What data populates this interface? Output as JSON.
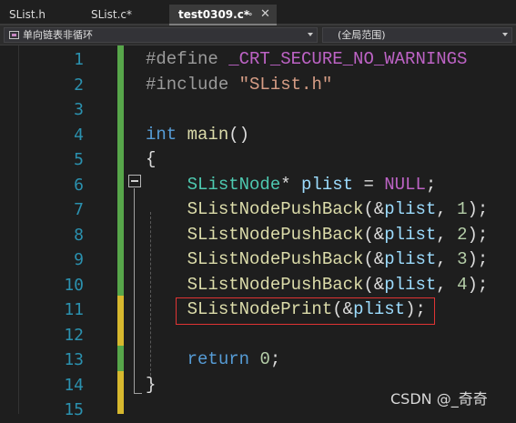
{
  "tabs": [
    {
      "label": "SList.h"
    },
    {
      "label": "SList.c*"
    },
    {
      "label": "test0309.c*",
      "active": true
    }
  ],
  "tab_icons": {
    "pin": "⊸",
    "close": "✕"
  },
  "navbar": {
    "scope_label": "单向链表非循环",
    "member_label": "(全局范围)"
  },
  "code_lines": [
    {
      "number": "1",
      "tokens": [
        {
          "t": "#define ",
          "c": "pp"
        },
        {
          "t": "_CRT_SECURE_NO_WARNINGS",
          "c": "cnst"
        }
      ]
    },
    {
      "number": "2",
      "tokens": [
        {
          "t": "#include ",
          "c": "pp"
        },
        {
          "t": "\"SList.h\"",
          "c": "str"
        }
      ]
    },
    {
      "number": "3",
      "tokens": []
    },
    {
      "number": "4",
      "tokens": [
        {
          "t": "int",
          "c": "kw"
        },
        {
          "t": " "
        },
        {
          "t": "main",
          "c": "fn"
        },
        {
          "t": "()"
        }
      ]
    },
    {
      "number": "5",
      "tokens": [
        {
          "t": "{"
        }
      ]
    },
    {
      "number": "6",
      "tokens": [
        {
          "t": "    "
        },
        {
          "t": "SListNode",
          "c": "type"
        },
        {
          "t": "* "
        },
        {
          "t": "plist",
          "c": "var"
        },
        {
          "t": " = "
        },
        {
          "t": "NULL",
          "c": "cnst"
        },
        {
          "t": ";"
        }
      ]
    },
    {
      "number": "7",
      "tokens": [
        {
          "t": "    "
        },
        {
          "t": "SListNodePushBack",
          "c": "fn"
        },
        {
          "t": "(&"
        },
        {
          "t": "plist",
          "c": "var"
        },
        {
          "t": ", "
        },
        {
          "t": "1",
          "c": "num"
        },
        {
          "t": ");"
        }
      ]
    },
    {
      "number": "8",
      "tokens": [
        {
          "t": "    "
        },
        {
          "t": "SListNodePushBack",
          "c": "fn"
        },
        {
          "t": "(&"
        },
        {
          "t": "plist",
          "c": "var"
        },
        {
          "t": ", "
        },
        {
          "t": "2",
          "c": "num"
        },
        {
          "t": ");"
        }
      ]
    },
    {
      "number": "9",
      "tokens": [
        {
          "t": "    "
        },
        {
          "t": "SListNodePushBack",
          "c": "fn"
        },
        {
          "t": "(&"
        },
        {
          "t": "plist",
          "c": "var"
        },
        {
          "t": ", "
        },
        {
          "t": "3",
          "c": "num"
        },
        {
          "t": ");"
        }
      ]
    },
    {
      "number": "10",
      "tokens": [
        {
          "t": "    "
        },
        {
          "t": "SListNodePushBack",
          "c": "fn"
        },
        {
          "t": "(&"
        },
        {
          "t": "plist",
          "c": "var"
        },
        {
          "t": ", "
        },
        {
          "t": "4",
          "c": "num"
        },
        {
          "t": ");"
        }
      ]
    },
    {
      "number": "11",
      "tokens": [
        {
          "t": "    "
        },
        {
          "t": "SListNodePrint",
          "c": "fn"
        },
        {
          "t": "(&"
        },
        {
          "t": "plist",
          "c": "var"
        },
        {
          "t": ");"
        }
      ]
    },
    {
      "number": "12",
      "tokens": []
    },
    {
      "number": "13",
      "tokens": [
        {
          "t": "    "
        },
        {
          "t": "return",
          "c": "kw"
        },
        {
          "t": " "
        },
        {
          "t": "0",
          "c": "num"
        },
        {
          "t": ";"
        }
      ]
    },
    {
      "number": "14",
      "tokens": [
        {
          "t": "}"
        }
      ]
    },
    {
      "number": "15",
      "tokens": []
    }
  ],
  "change_markers": [
    {
      "from_line": 1,
      "to_line": 10,
      "color": "#57a64a"
    },
    {
      "from_line": 11,
      "to_line": 12,
      "color": "#d7b82e"
    },
    {
      "from_line": 13,
      "to_line": 13,
      "color": "#57a64a"
    },
    {
      "from_line": 14,
      "to_line": 15,
      "color": "#d7b82e"
    }
  ],
  "highlighted_line": 11,
  "colors": {
    "keyword": "#569cd6",
    "function": "#dcdcaa",
    "type": "#4ec9b0",
    "variable": "#9cdcfe",
    "number": "#b5cea8",
    "line_number": "#2b91af",
    "highlight_border": "#e03434"
  },
  "watermark": "CSDN @_奇奇"
}
